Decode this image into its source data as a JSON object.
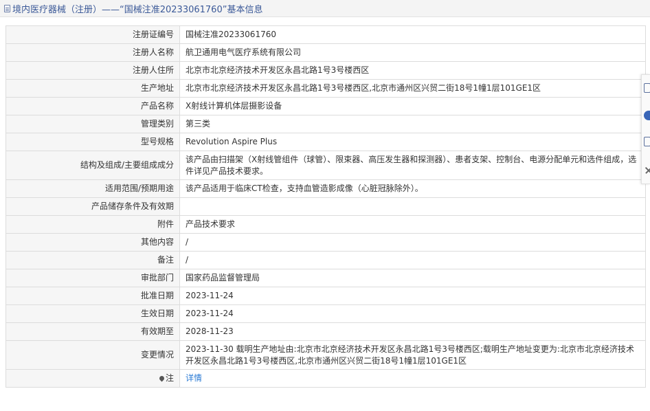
{
  "header": {
    "title": "境内医疗器械（注册）——“国械注准20233061760”基本信息"
  },
  "fields": [
    {
      "label": "注册证编号",
      "value": "国械注准20233061760"
    },
    {
      "label": "注册人名称",
      "value": "航卫通用电气医疗系统有限公司"
    },
    {
      "label": "注册人住所",
      "value": "北京市北京经济技术开发区永昌北路1号3号楼西区"
    },
    {
      "label": "生产地址",
      "value": "北京市北京经济技术开发区永昌北路1号3号楼西区,北京市通州区兴贸二街18号1幢1层101GE1区"
    },
    {
      "label": "产品名称",
      "value": "X射线计算机体层摄影设备"
    },
    {
      "label": "管理类别",
      "value": "第三类"
    },
    {
      "label": "型号规格",
      "value": "Revolution Aspire Plus"
    },
    {
      "label": "结构及组成/主要组成成分",
      "value": "该产品由扫描架（X射线管组件（球管）、限束器、高压发生器和探测器）、患者支架、控制台、电源分配单元和选件组成，选件详见产品技术要求。"
    },
    {
      "label": "适用范围/预期用途",
      "value": "该产品适用于临床CT检查，支持血管造影成像（心脏冠脉除外）。"
    },
    {
      "label": "产品储存条件及有效期",
      "value": ""
    },
    {
      "label": "附件",
      "value": "产品技术要求"
    },
    {
      "label": "其他内容",
      "value": "/"
    },
    {
      "label": "备注",
      "value": "/"
    },
    {
      "label": "审批部门",
      "value": "国家药品监督管理局"
    },
    {
      "label": "批准日期",
      "value": "2023-11-24"
    },
    {
      "label": "生效日期",
      "value": "2023-11-24"
    },
    {
      "label": "有效期至",
      "value": "2028-11-23"
    },
    {
      "label": "变更情况",
      "value": "2023-11-30 载明生产地址由:北京市北京经济技术开发区永昌北路1号3号楼西区;载明生产地址变更为:北京市北京经济技术开发区永昌北路1号3号楼西区,北京市通州区兴贸二街18号1幢1层101GE1区"
    }
  ],
  "note_row": {
    "label": "注",
    "link_text": "详情"
  },
  "side_toolbar": {
    "icons": [
      "edit-icon",
      "help-icon",
      "copy-icon",
      "close-icon"
    ]
  },
  "colors": {
    "header_text": "#3b5998",
    "label_bg": "#f6f6f6",
    "border": "#dcdcdc",
    "link": "#2a7ad4"
  }
}
